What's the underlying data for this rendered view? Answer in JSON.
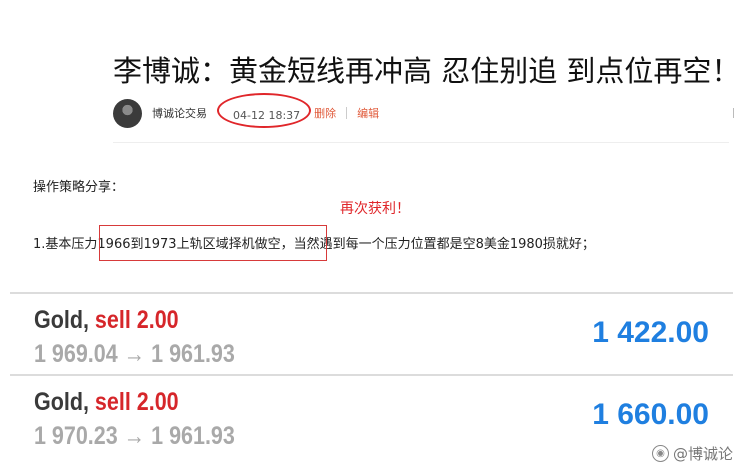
{
  "article": {
    "title": "李博诚：黄金短线再冲高 忍住别追 到点位再空！",
    "author": "博诚论交易",
    "time": "04-12 18:37",
    "delete_label": "删除",
    "edit_label": "编辑"
  },
  "body": {
    "intro": "操作策略分享：",
    "annotation": "再次获利！",
    "line_prefix": "1.基本压力",
    "line_boxed": "1966到1973上轨区域择机做空",
    "line_suffix": "，当然遇到每一个压力位置都是空8美金1980损就好；"
  },
  "trades": [
    {
      "symbol": "Gold",
      "comma": ",",
      "side": "sell 2.00",
      "prices": "1 969.04 → 1 961.93",
      "profit": "1 422.00"
    },
    {
      "symbol": "Gold",
      "comma": ",",
      "side": "sell 2.00",
      "prices": "1 970.23 → 1 961.93",
      "profit": "1 660.00"
    }
  ],
  "watermark": {
    "icon": "weibo-at-icon",
    "text": "@博诚论"
  },
  "colors": {
    "accent_red": "#e0262a",
    "profit_blue": "#1f7fe0",
    "grey_text": "#a9a9a9"
  }
}
